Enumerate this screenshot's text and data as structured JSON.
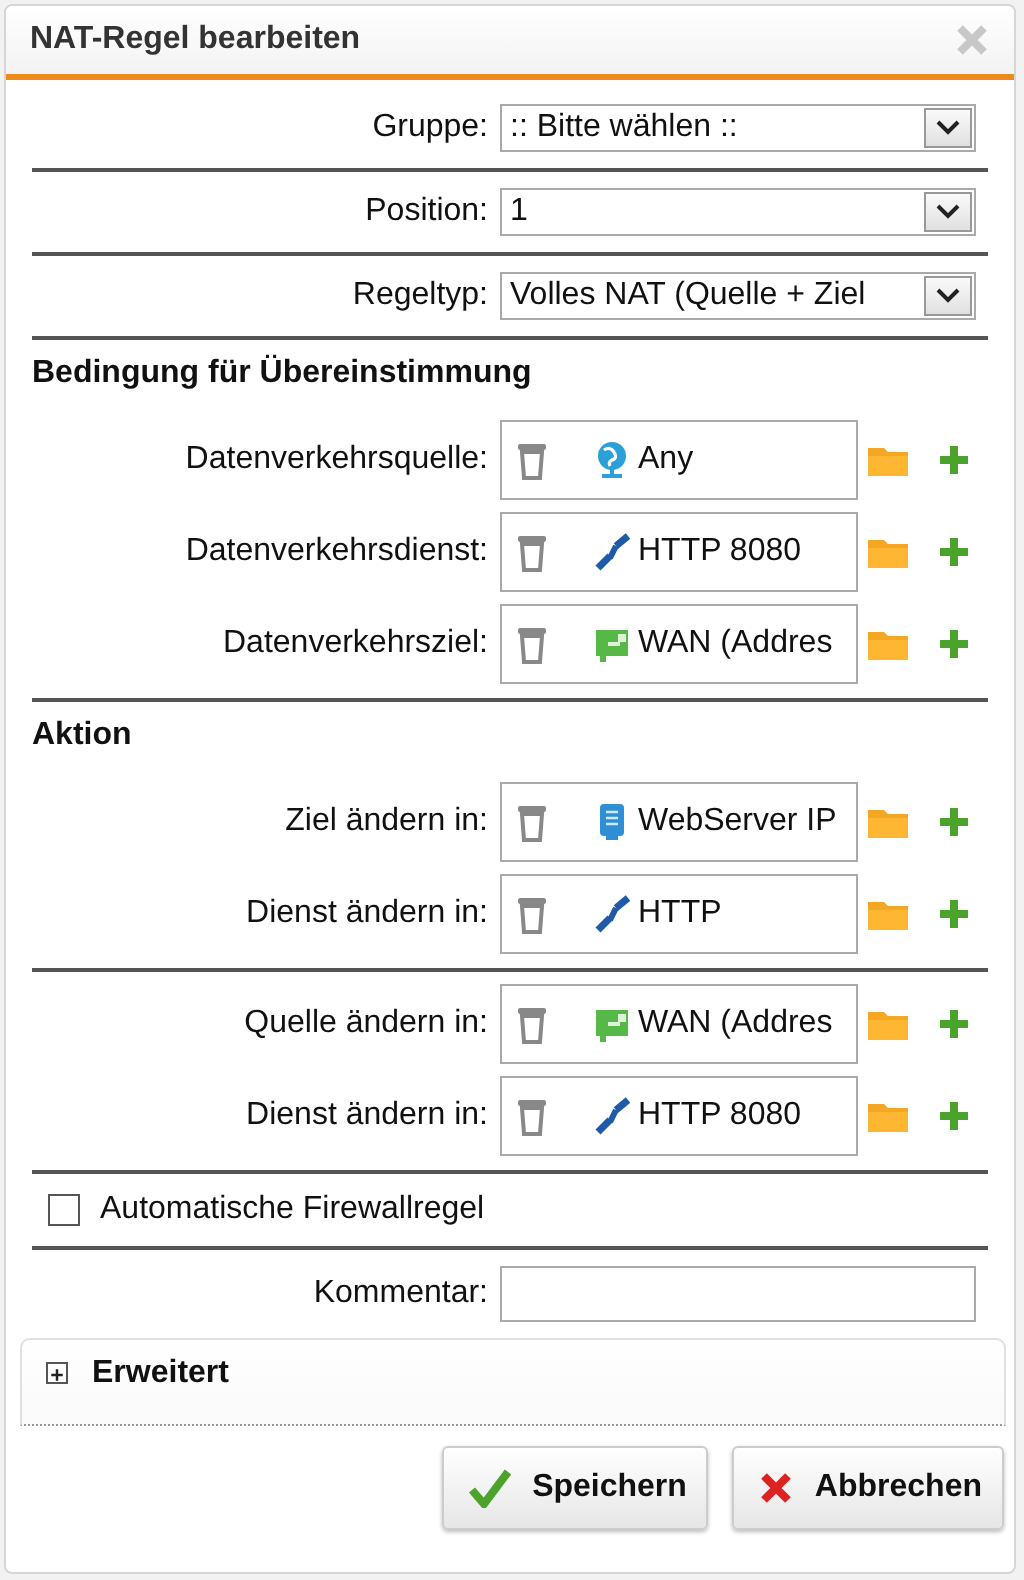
{
  "dialog": {
    "title": "NAT-Regel bearbeiten"
  },
  "fields": [
    {
      "label": "Gruppe:",
      "value": ":: Bitte wählen ::"
    },
    {
      "label": "Position:",
      "value": "1"
    },
    {
      "label": "Regeltyp:",
      "value": "Volles NAT (Quelle + Ziel"
    }
  ],
  "sections": [
    {
      "title": "Bedingung für Übereinstimmung",
      "groups": [
        [
          {
            "label": "Datenverkehrsquelle:",
            "kind": "network",
            "value": "Any"
          },
          {
            "label": "Datenverkehrsdienst:",
            "kind": "service",
            "value": "HTTP 8080"
          },
          {
            "label": "Datenverkehrsziel:",
            "kind": "interface",
            "value": "WAN (Addres"
          }
        ]
      ]
    },
    {
      "title": "Aktion",
      "groups": [
        [
          {
            "label": "Ziel ändern in:",
            "kind": "host",
            "value": "WebServer IP"
          },
          {
            "label": "Dienst ändern in:",
            "kind": "service",
            "value": "HTTP"
          }
        ],
        [
          {
            "label": "Quelle ändern in:",
            "kind": "interface",
            "value": "WAN (Addres"
          },
          {
            "label": "Dienst ändern in:",
            "kind": "service",
            "value": "HTTP 8080"
          }
        ]
      ]
    }
  ],
  "auto_firewall": {
    "label": "Automatische Firewallregel",
    "checked": false
  },
  "comment": {
    "label": "Kommentar:"
  },
  "advanced": {
    "label": "Erweitert",
    "expanded": false
  },
  "buttons": [
    {
      "label": "Speichern",
      "kind": "save"
    },
    {
      "label": "Abbrechen",
      "kind": "cancel"
    }
  ]
}
